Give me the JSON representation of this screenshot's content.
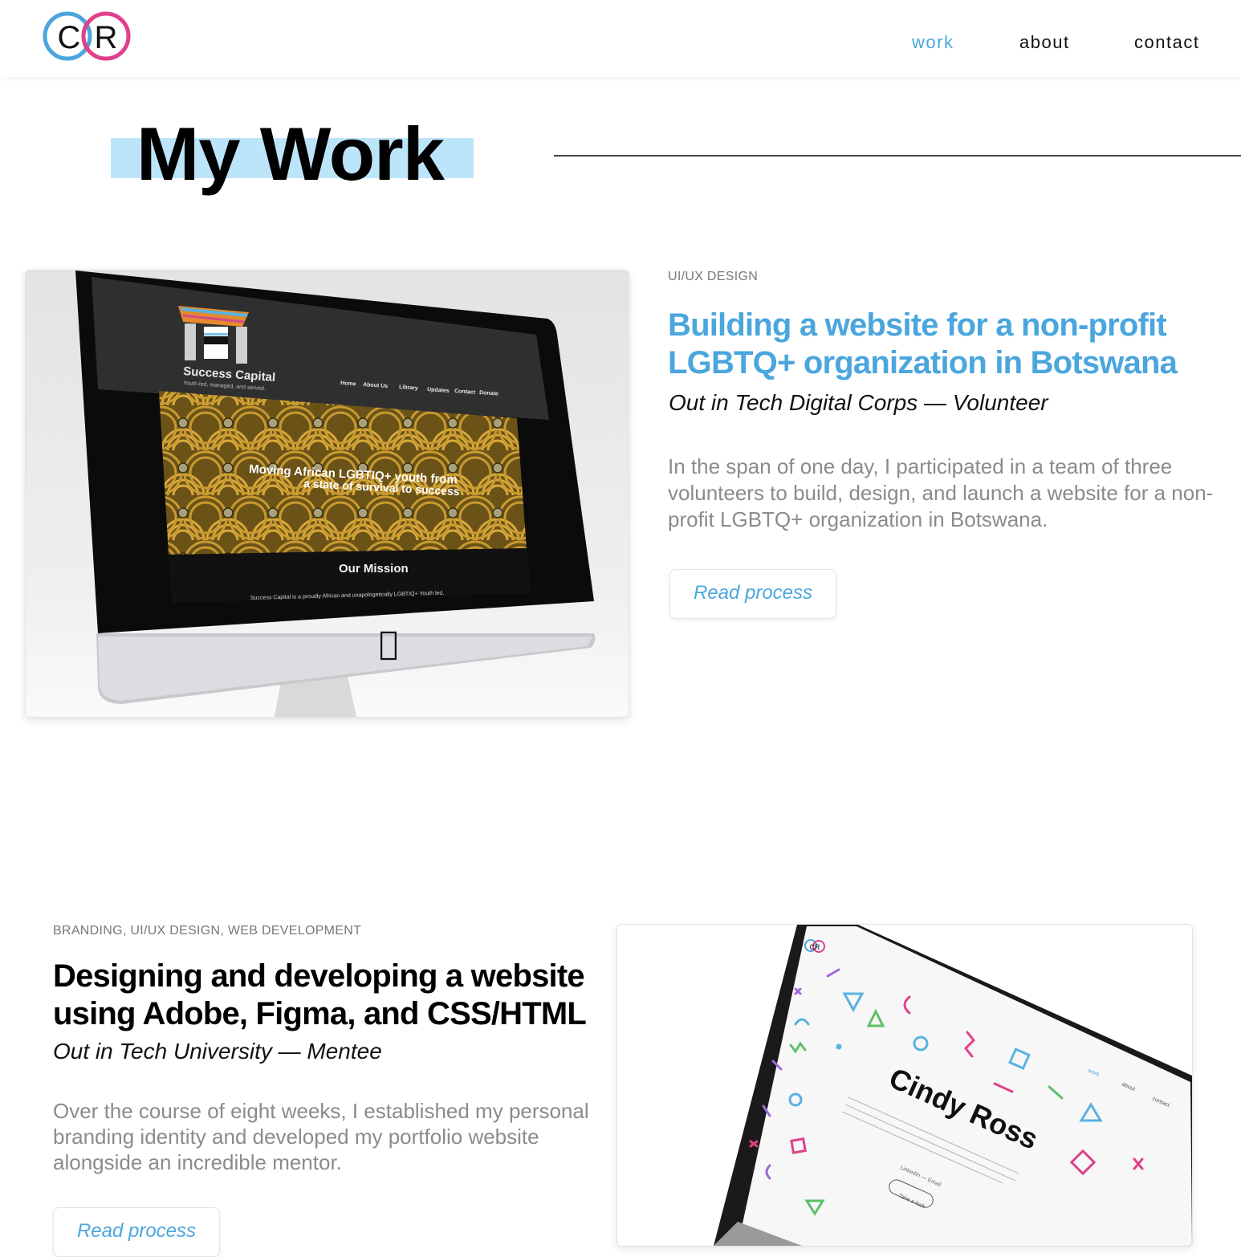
{
  "header": {
    "logo_letters": "CR",
    "nav": [
      {
        "label": "work",
        "active": true
      },
      {
        "label": "about",
        "active": false
      },
      {
        "label": "contact",
        "active": false
      }
    ]
  },
  "page_title": "My Work",
  "colors": {
    "accent": "#4aa6dd",
    "highlight": "#bde5fa",
    "pink": "#e0408a"
  },
  "projects": [
    {
      "category": "UI/UX DESIGN",
      "title": "Building a website for a non-profit LGBTQ+ organization in Botswana",
      "role": "Out in Tech Digital Corps — Volunteer",
      "description": "In the span of one day, I participated in a team of three volunteers to build, design, and launch a website for a non-profit LGBTQ+ organization in Botswana.",
      "button_label": "Read process",
      "mockup": {
        "site_name": "Success Capital",
        "site_tagline": "Youth-led, managed, and served.",
        "site_nav": [
          "Home",
          "About Us",
          "Library",
          "Updates",
          "Contact",
          "Donate"
        ],
        "hero_line1": "Moving African LGBTIQ+ youth from",
        "hero_line2": "a state of survival to success",
        "mission_heading": "Our Mission",
        "mission_text": "Success Capital is a proudly African and unapologetically LGBTIQ+ Youth led,"
      }
    },
    {
      "category": "BRANDING, UI/UX DESIGN, WEB DEVELOPMENT",
      "title": "Designing and developing a website using Adobe, Figma, and CSS/HTML",
      "role": "Out in Tech University — Mentee",
      "description": "Over the course of eight weeks, I established my personal branding identity and developed my portfolio website alongside an incredible mentor.",
      "button_label": "Read process",
      "mockup": {
        "logo_letters": "CR",
        "name": "Cindy Ross",
        "nav": [
          "work",
          "about",
          "contact"
        ],
        "links": "LinkedIn — Email",
        "button": "Take a look"
      }
    }
  ]
}
